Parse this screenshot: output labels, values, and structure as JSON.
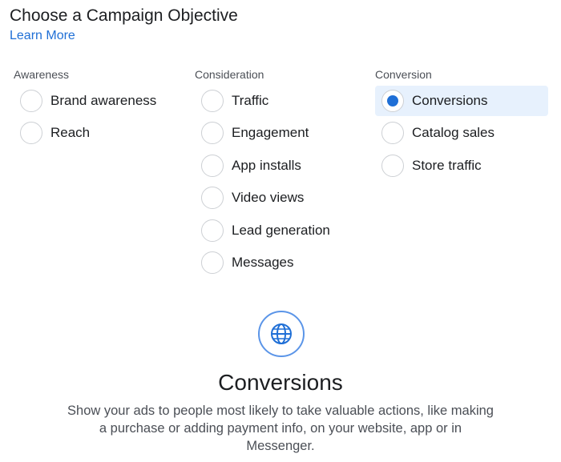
{
  "header": {
    "title": "Choose a Campaign Objective",
    "learn_more": "Learn More"
  },
  "columns": {
    "awareness": {
      "heading": "Awareness",
      "options": [
        "Brand awareness",
        "Reach"
      ]
    },
    "consideration": {
      "heading": "Consideration",
      "options": [
        "Traffic",
        "Engagement",
        "App installs",
        "Video views",
        "Lead generation",
        "Messages"
      ]
    },
    "conversion": {
      "heading": "Conversion",
      "options": [
        "Conversions",
        "Catalog sales",
        "Store traffic"
      ]
    }
  },
  "selected": "Conversions",
  "detail": {
    "icon": "globe-icon",
    "title": "Conversions",
    "description": "Show your ads to people most likely to take valuable actions, like making a purchase or adding payment info, on your website, app or in Messenger."
  },
  "colors": {
    "accent": "#1f6fd6",
    "selected_bg": "#e7f1fd"
  }
}
